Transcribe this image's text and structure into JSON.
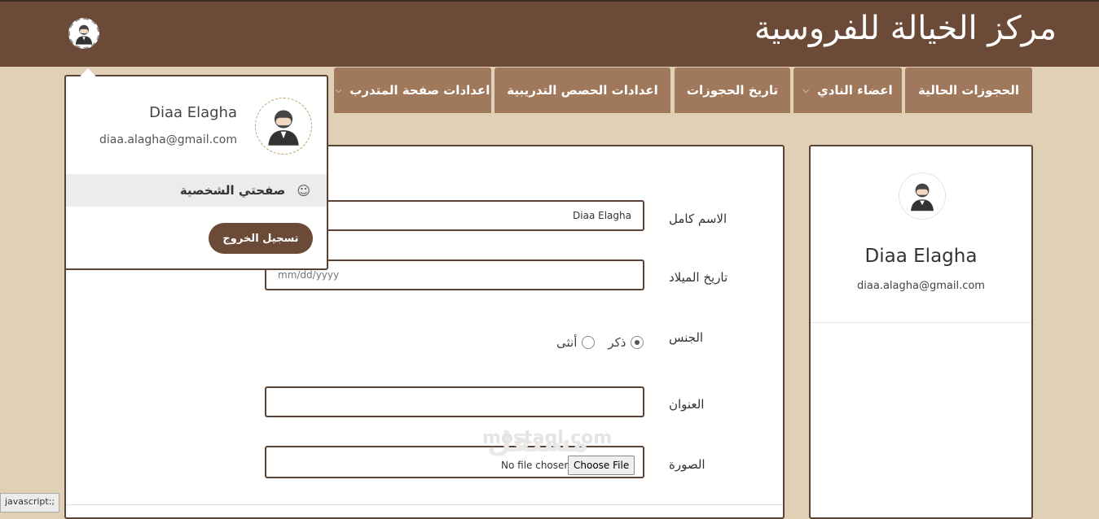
{
  "header": {
    "site_title": "مركز الخيالة للفروسية"
  },
  "nav": {
    "items": [
      {
        "label": "الحجوزات الحالية",
        "has_dropdown": false
      },
      {
        "label": "اعضاء النادي",
        "has_dropdown": true
      },
      {
        "label": "تاريخ الحجوزات",
        "has_dropdown": false
      },
      {
        "label": "اعدادات الحصص التدريبية",
        "has_dropdown": false
      },
      {
        "label": "اعدادات صفحة المتدرب",
        "has_dropdown": true
      }
    ]
  },
  "user_menu": {
    "name": "Diaa Elagha",
    "email": "diaa.alagha@gmail.com",
    "profile_link": "صفحتي الشخصية",
    "logout_button": "تسجيل الخروج"
  },
  "form": {
    "full_name_label": "الاسم كامل",
    "full_name_value": "Diaa Elagha",
    "birth_date_label": "تاريخ الميلاد",
    "birth_date_placeholder": "mm/dd/yyyy",
    "gender_label": "الجنس",
    "gender_male": "ذكر",
    "gender_female": "أنثى",
    "gender_selected": "male",
    "address_label": "العنوان",
    "address_value": "",
    "photo_label": "الصورة",
    "no_file_text": "No file chosen",
    "choose_file_button": "Choose File"
  },
  "profile_card": {
    "name": "Diaa Elagha",
    "email": "diaa.alagha@gmail.com"
  },
  "watermark": {
    "latin": "mostaql.com",
    "arabic": "مستقل"
  },
  "status_bar": {
    "text": "javascript:;"
  },
  "colors": {
    "header_bg": "#6b4a38",
    "nav_bg": "#a0795d",
    "page_bg": "#e0d0b6",
    "border": "#5a4234"
  }
}
